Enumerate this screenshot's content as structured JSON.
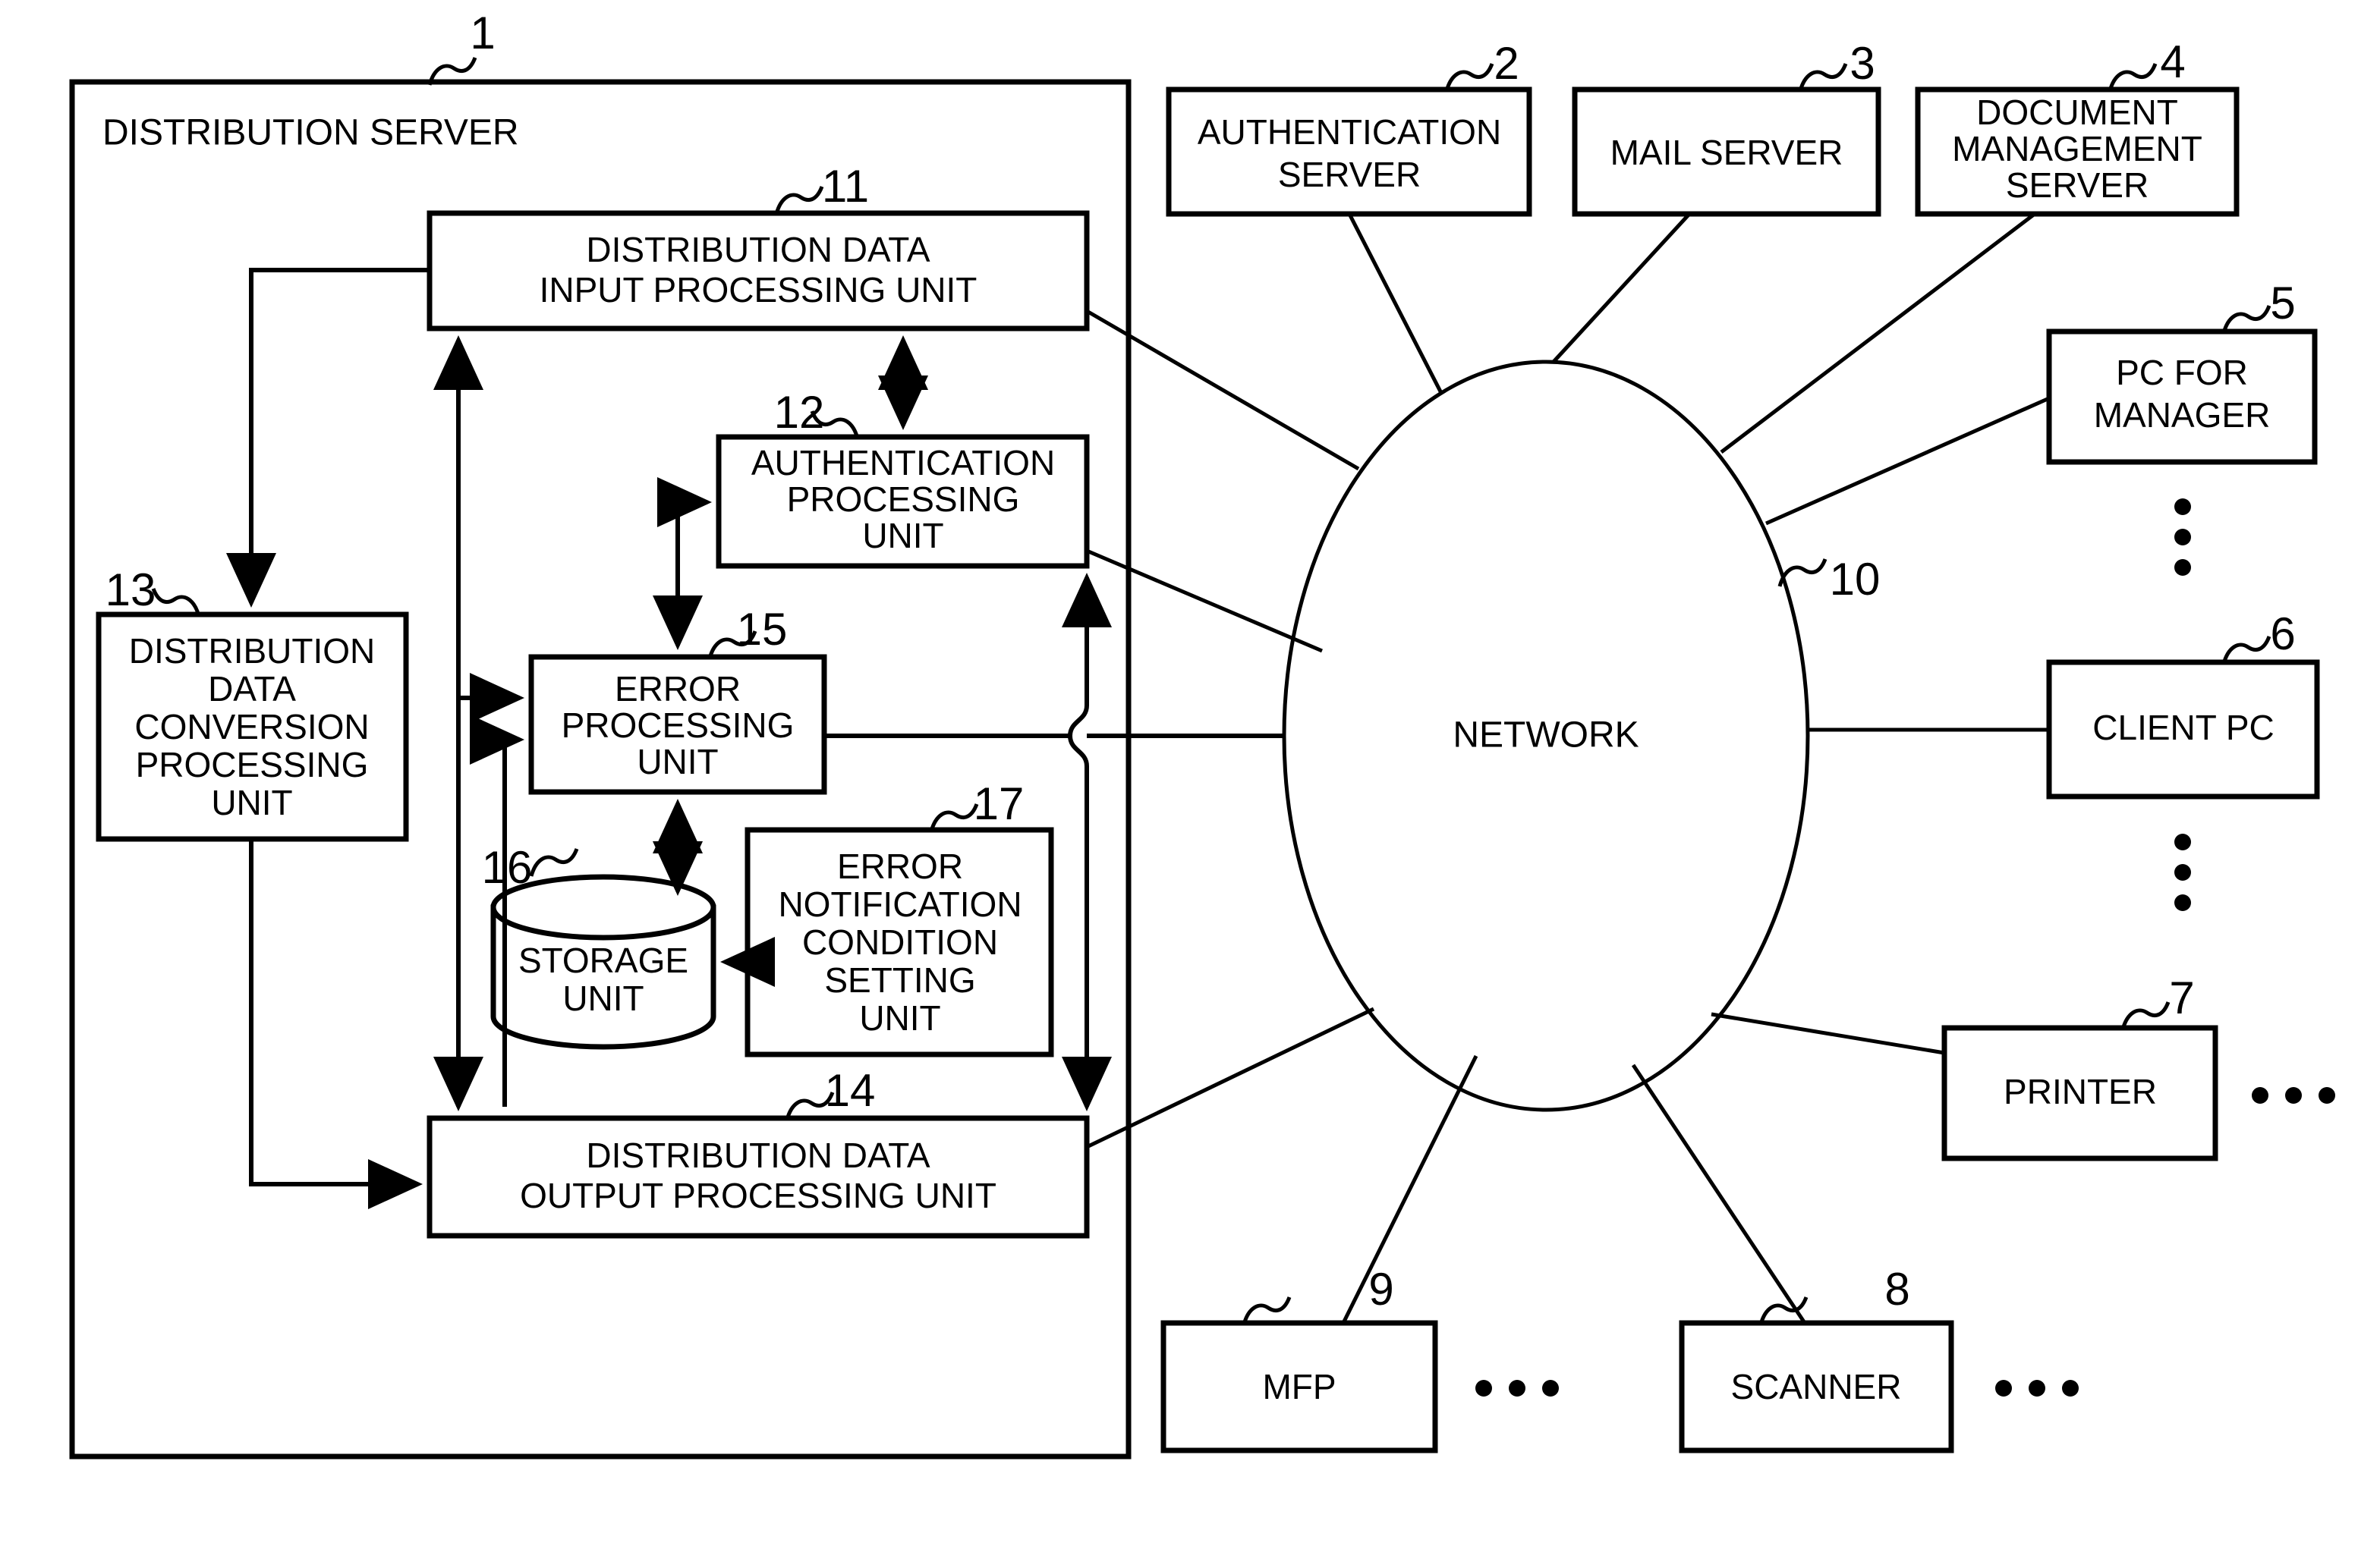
{
  "figure": {
    "frame_label": "DISTRIBUTION SERVER",
    "frame_ref": "1"
  },
  "internal_units": [
    {
      "id": "11",
      "label_lines": [
        "DISTRIBUTION DATA",
        "INPUT PROCESSING UNIT"
      ],
      "ref": "11"
    },
    {
      "id": "12",
      "label_lines": [
        "AUTHENTICATION",
        "PROCESSING",
        "UNIT"
      ],
      "ref": "12"
    },
    {
      "id": "13",
      "label_lines": [
        "DISTRIBUTION",
        "DATA",
        "CONVERSION",
        "PROCESSING",
        "UNIT"
      ],
      "ref": "13"
    },
    {
      "id": "14",
      "label_lines": [
        "DISTRIBUTION DATA",
        "OUTPUT PROCESSING UNIT"
      ],
      "ref": "14"
    },
    {
      "id": "15",
      "label_lines": [
        "ERROR",
        "PROCESSING",
        "UNIT"
      ],
      "ref": "15"
    },
    {
      "id": "16",
      "label_lines": [
        "STORAGE",
        "UNIT"
      ],
      "ref": "16"
    },
    {
      "id": "17",
      "label_lines": [
        "ERROR",
        "NOTIFICATION",
        "CONDITION",
        "SETTING",
        "UNIT"
      ],
      "ref": "17"
    }
  ],
  "external_nodes": [
    {
      "id": "2",
      "label_lines": [
        "AUTHENTICATION",
        "SERVER"
      ],
      "ref": "2"
    },
    {
      "id": "3",
      "label_lines": [
        "MAIL SERVER"
      ],
      "ref": "3"
    },
    {
      "id": "4",
      "label_lines": [
        "DOCUMENT",
        "MANAGEMENT",
        "SERVER"
      ],
      "ref": "4"
    },
    {
      "id": "5",
      "label_lines": [
        "PC FOR",
        "MANAGER"
      ],
      "ref": "5"
    },
    {
      "id": "6",
      "label_lines": [
        "CLIENT PC"
      ],
      "ref": "6"
    },
    {
      "id": "7",
      "label_lines": [
        "PRINTER"
      ],
      "ref": "7"
    },
    {
      "id": "8",
      "label_lines": [
        "SCANNER"
      ],
      "ref": "8"
    },
    {
      "id": "9",
      "label_lines": [
        "MFP"
      ],
      "ref": "9"
    }
  ],
  "network": {
    "label": "NETWORK",
    "ref": "10"
  },
  "colors": {
    "ink": "#000000",
    "paper": "#ffffff"
  },
  "text": {
    "u11_l1": "DISTRIBUTION DATA",
    "u11_l2": "INPUT PROCESSING UNIT",
    "u12_l1": "AUTHENTICATION",
    "u12_l2": "PROCESSING",
    "u12_l3": "UNIT",
    "u13_l1": "DISTRIBUTION",
    "u13_l2": "DATA",
    "u13_l3": "CONVERSION",
    "u13_l4": "PROCESSING",
    "u13_l5": "UNIT",
    "u14_l1": "DISTRIBUTION DATA",
    "u14_l2": "OUTPUT PROCESSING UNIT",
    "u15_l1": "ERROR",
    "u15_l2": "PROCESSING",
    "u15_l3": "UNIT",
    "u16_l1": "STORAGE",
    "u16_l2": "UNIT",
    "u17_l1": "ERROR",
    "u17_l2": "NOTIFICATION",
    "u17_l3": "CONDITION",
    "u17_l4": "SETTING",
    "u17_l5": "UNIT",
    "n2_l1": "AUTHENTICATION",
    "n2_l2": "SERVER",
    "n3_l1": "MAIL SERVER",
    "n4_l1": "DOCUMENT",
    "n4_l2": "MANAGEMENT",
    "n4_l3": "SERVER",
    "n5_l1": "PC FOR",
    "n5_l2": "MANAGER",
    "n6_l1": "CLIENT PC",
    "n7_l1": "PRINTER",
    "n8_l1": "SCANNER",
    "n9_l1": "MFP",
    "net_label": "NETWORK",
    "frame_label": "DISTRIBUTION SERVER",
    "ref1": "1",
    "ref2": "2",
    "ref3": "3",
    "ref4": "4",
    "ref5": "5",
    "ref6": "6",
    "ref7": "7",
    "ref8": "8",
    "ref9": "9",
    "ref10": "10",
    "ref11": "11",
    "ref12": "12",
    "ref13": "13",
    "ref14": "14",
    "ref15": "15",
    "ref16": "16",
    "ref17": "17"
  }
}
